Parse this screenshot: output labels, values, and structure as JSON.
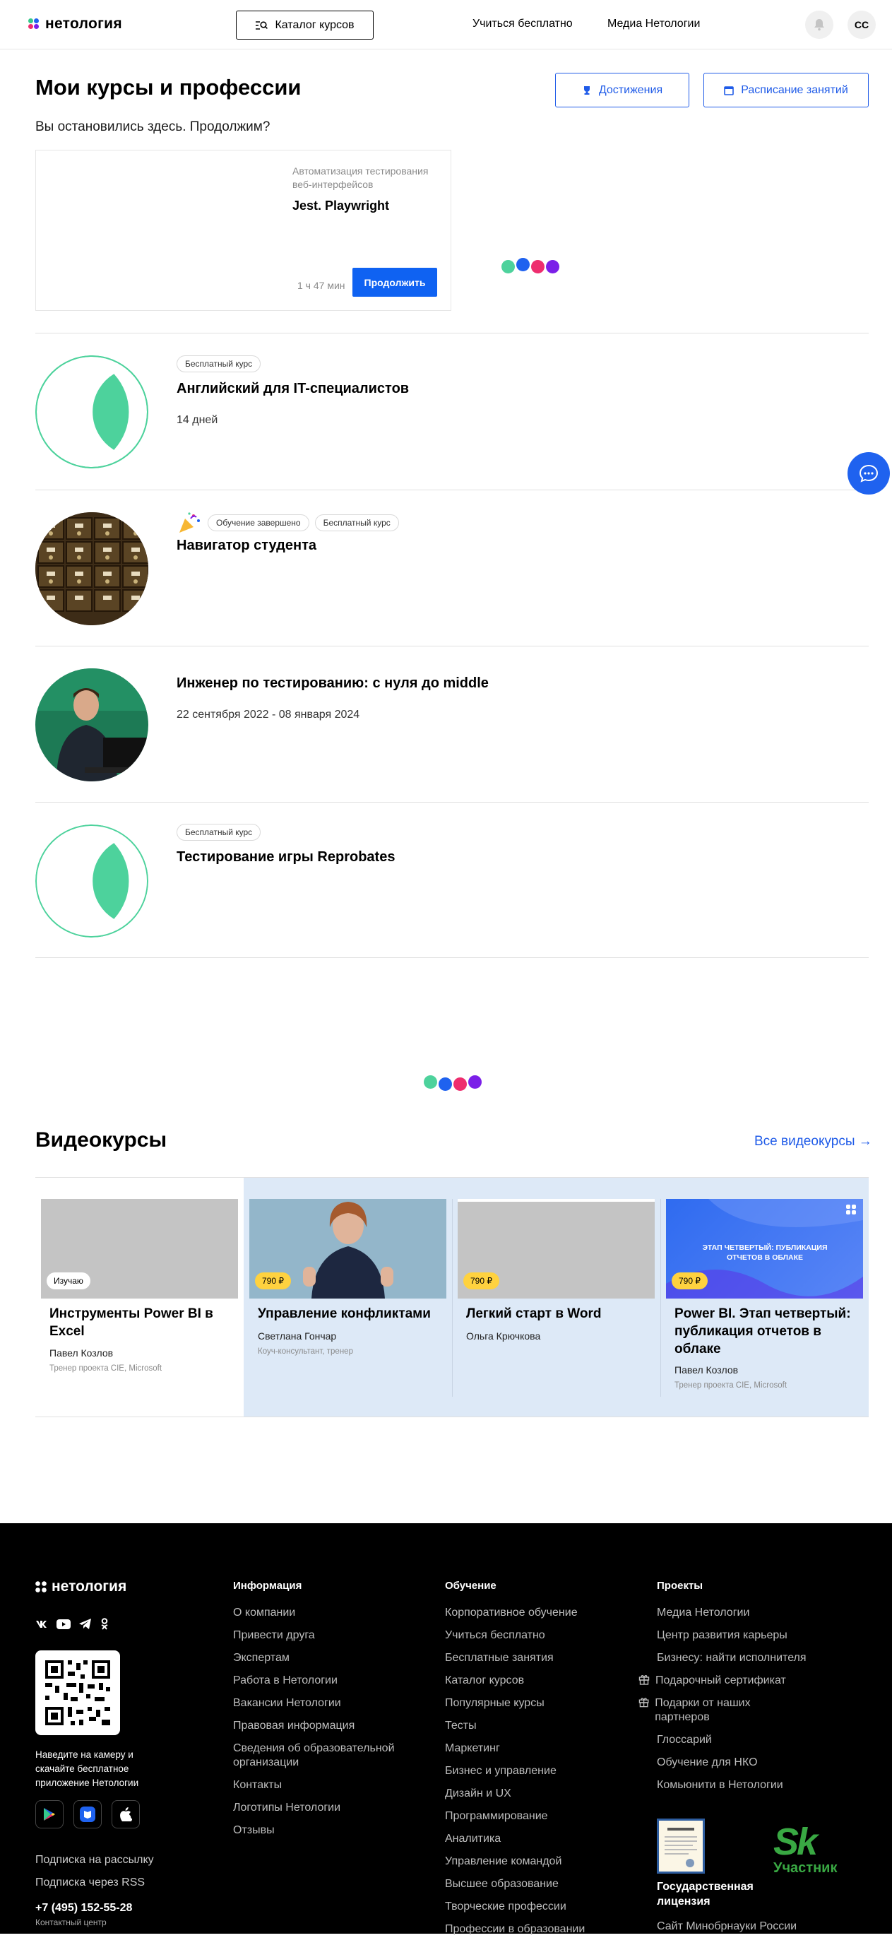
{
  "header": {
    "logo_text": "нетология",
    "catalog_label": "Каталог курсов",
    "nav": [
      "Учиться бесплатно",
      "Медиа Нетологии"
    ],
    "avatar_initials": "СС"
  },
  "page": {
    "title": "Мои курсы и профессии",
    "achievements_label": "Достижения",
    "schedule_label": "Расписание занятий",
    "subtitle": "Вы остановились здесь. Продолжим?"
  },
  "continue_card": {
    "category": "Автоматизация тестирования веб-интерфейсов",
    "lesson": "Jest. Playwright",
    "duration": "1 ч 47 мин",
    "button": "Продолжить"
  },
  "courses": [
    {
      "badges": [
        "Бесплатный курс"
      ],
      "title": "Английский для IT-специалистов",
      "meta": "14 дней"
    },
    {
      "badges": [
        "Обучение завершено",
        "Бесплатный курс"
      ],
      "title": "Навигатор студента",
      "meta": ""
    },
    {
      "badges": [],
      "title": "Инженер по тестированию: с нуля до middle",
      "meta": "22 сентября 2022 - 08 января 2024"
    },
    {
      "badges": [
        "Бесплатный курс"
      ],
      "title": "Тестирование игры Reprobates",
      "meta": ""
    }
  ],
  "videos": {
    "title": "Видеокурсы",
    "all_label": "Все видеокурсы →",
    "items": [
      {
        "tag": "Изучаю",
        "title": "Инструменты Power BI в Excel",
        "author": "Павел Козлов",
        "role": "Тренер проекта CIE, Microsoft"
      },
      {
        "tag": "790 ₽",
        "title": "Управление конфликтами",
        "author": "Светлана Гончар",
        "role": "Коуч-консультант, тренер"
      },
      {
        "tag": "790 ₽",
        "title": "Легкий старт в Word",
        "author": "Ольга Крючкова",
        "role": ""
      },
      {
        "tag": "790 ₽",
        "title": "Power BI. Этап четвертый: публикация отчетов в облаке",
        "author": "Павел Козлов",
        "role": "Тренер проекта CIE, Microsoft",
        "banner": "ЭТАП ЧЕТВЕРТЫЙ: ПУБЛИКАЦИЯ ОТЧЕТОВ В ОБЛАКЕ"
      }
    ]
  },
  "footer": {
    "logo_text": "нетология",
    "qr_text": "Наведите на камеру и скачайте бесплатное приложение Нетологии",
    "subscribe": "Подписка на рассылку",
    "rss": "Подписка через RSS",
    "phone": "+7 (495) 152-55-28",
    "contact_label": "Контактный центр",
    "columns": [
      {
        "title": "Информация",
        "items": [
          "О компании",
          "Привести друга",
          "Экспертам",
          "Работа в Нетологии",
          "Вакансии Нетологии",
          "Правовая информация",
          "Сведения об образовательной организации",
          "Контакты",
          "Логотипы Нетологии",
          "Отзывы"
        ]
      },
      {
        "title": "Обучение",
        "items": [
          "Корпоративное обучение",
          "Учиться бесплатно",
          "Бесплатные занятия",
          "Каталог курсов",
          "Популярные курсы",
          "Тесты",
          "Маркетинг",
          "Бизнес и управление",
          "Дизайн и UX",
          "Программирование",
          "Аналитика",
          "Управление командой",
          "Высшее образование",
          "Творческие профессии",
          "Профессии в образовании"
        ]
      },
      {
        "title": "Проекты",
        "items": [
          "Медиа Нетологии",
          "Центр развития карьеры",
          "Бизнесу: найти исполнителя",
          "Подарочный сертификат",
          "Подарки от наших партнеров",
          "Глоссарий",
          "Обучение для НКО",
          "Комьюнити в Нетологии"
        ]
      }
    ],
    "license_label": "Государственная лицензия",
    "sk_label": "Участник",
    "minobr": "Сайт Минобрнауки России"
  },
  "colors": {
    "accent": "#1f5be8",
    "button": "#0f62f2",
    "green": "#4dd29c",
    "video_bg": "#dde9f7"
  }
}
